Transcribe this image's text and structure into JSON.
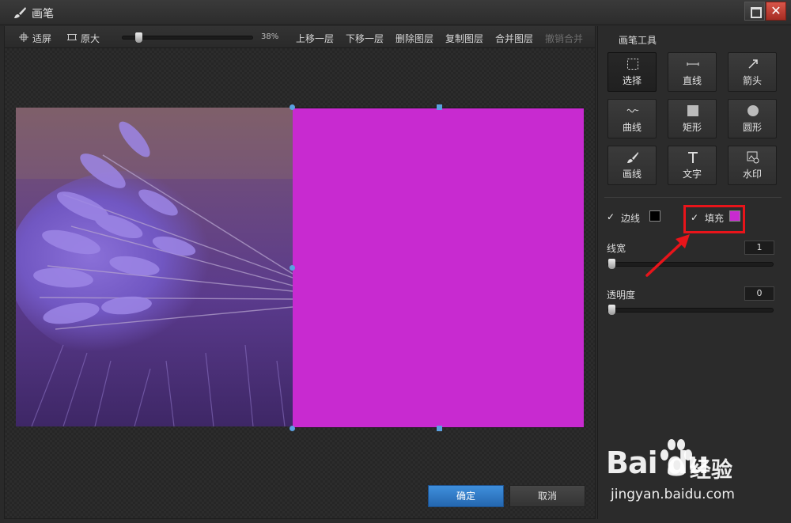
{
  "window": {
    "title": "画笔"
  },
  "toolbar": {
    "fit_label": "适屏",
    "original_label": "原大",
    "zoom": "38%",
    "zoom_fraction": 0.1,
    "move_up": "上移一层",
    "move_down": "下移一层",
    "delete_layer": "删除图层",
    "copy_layer": "复制图层",
    "merge_layer": "合并图层",
    "undo_merge": "撤销合并"
  },
  "panel": {
    "title": "画笔工具",
    "tools": [
      {
        "label": "选择",
        "icon": "select-icon"
      },
      {
        "label": "直线",
        "icon": "line-icon"
      },
      {
        "label": "箭头",
        "icon": "arrow-icon"
      },
      {
        "label": "曲线",
        "icon": "curve-icon"
      },
      {
        "label": "矩形",
        "icon": "rectangle-icon"
      },
      {
        "label": "圆形",
        "icon": "circle-icon"
      },
      {
        "label": "画线",
        "icon": "brush-icon"
      },
      {
        "label": "文字",
        "icon": "text-icon"
      },
      {
        "label": "水印",
        "icon": "watermark-icon"
      }
    ],
    "border_label": "边线",
    "border_color": "#000000",
    "fill_label": "填充",
    "fill_color": "#c82ad0",
    "line_width_label": "线宽",
    "line_width_value": "1",
    "opacity_label": "透明度",
    "opacity_value": "0"
  },
  "buttons": {
    "ok": "确定",
    "cancel": "取消"
  },
  "watermark": {
    "logo_text": "Bai du",
    "cn_text": "经验",
    "url": "jingyan.baidu.com"
  }
}
